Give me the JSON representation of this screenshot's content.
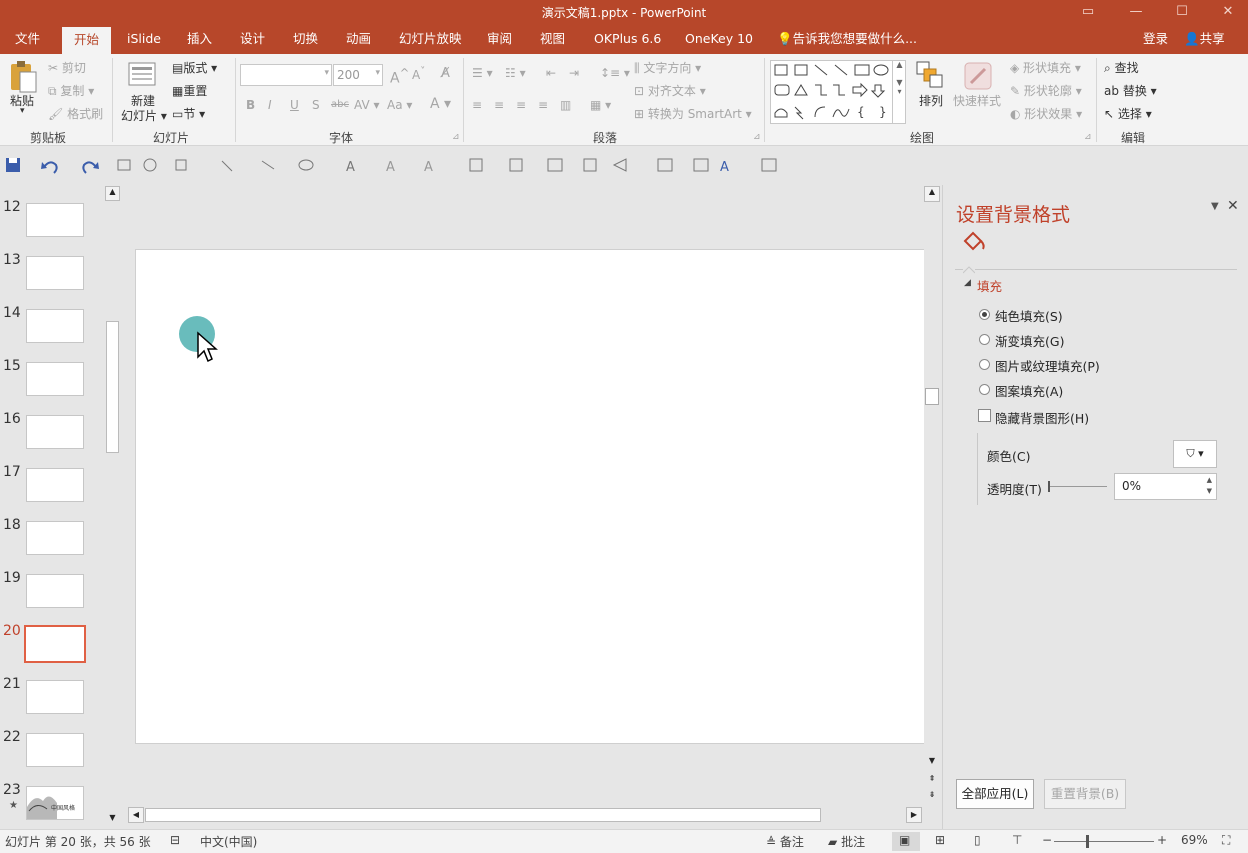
{
  "window": {
    "title": "演示文稿1.pptx - PowerPoint"
  },
  "tabs": [
    "文件",
    "开始",
    "iSlide",
    "插入",
    "设计",
    "切换",
    "动画",
    "幻灯片放映",
    "审阅",
    "视图",
    "OKPlus 6.6",
    "OneKey 10"
  ],
  "active_tab": "开始",
  "tell_me": "告诉我您想要做什么...",
  "account": {
    "login": "登录",
    "share": "共享"
  },
  "ribbon": {
    "clipboard": {
      "paste": "粘贴",
      "cut": "剪切",
      "copy": "复制",
      "format_painter": "格式刷",
      "label": "剪贴板"
    },
    "slides": {
      "new_slide_1": "新建",
      "new_slide_2": "幻灯片",
      "layout": "版式",
      "reset": "重置",
      "section": "节",
      "label": "幻灯片"
    },
    "font": {
      "name": "",
      "size": "200",
      "label": "字体",
      "bold": "B",
      "italic": "I",
      "underline": "U",
      "shadow": "S",
      "strike": "abc",
      "spacing": "AV",
      "case": "Aa",
      "color": "A"
    },
    "paragraph": {
      "text_direction": "文字方向",
      "align_text": "对齐文本",
      "smartart": "转换为 SmartArt",
      "label": "段落"
    },
    "drawing": {
      "arrange": "排列",
      "quick_styles": "快速样式",
      "shape_fill": "形状填充",
      "shape_outline": "形状轮廓",
      "shape_effects": "形状效果",
      "label": "绘图"
    },
    "editing": {
      "find": "查找",
      "replace": "替换",
      "select": "选择",
      "label": "编辑"
    }
  },
  "thumbnails": [
    {
      "num": "12",
      "selected": false
    },
    {
      "num": "13",
      "selected": false
    },
    {
      "num": "14",
      "selected": false
    },
    {
      "num": "15",
      "selected": false
    },
    {
      "num": "16",
      "selected": false
    },
    {
      "num": "17",
      "selected": false
    },
    {
      "num": "18",
      "selected": false
    },
    {
      "num": "19",
      "selected": false
    },
    {
      "num": "20",
      "selected": true
    },
    {
      "num": "21",
      "selected": false
    },
    {
      "num": "22",
      "selected": false
    },
    {
      "num": "23",
      "selected": false
    }
  ],
  "thumbnail_23_star": "★",
  "thumbnail_23_caption": "中国风格",
  "pane": {
    "title": "设置背景格式",
    "section": "填充",
    "options": [
      {
        "label": "纯色填充(S)",
        "selected": true
      },
      {
        "label": "渐变填充(G)",
        "selected": false
      },
      {
        "label": "图片或纹理填充(P)",
        "selected": false
      },
      {
        "label": "图案填充(A)",
        "selected": false
      }
    ],
    "hide_bg": "隐藏背景图形(H)",
    "color_label": "颜色(C)",
    "transparency_label": "透明度(T)",
    "transparency_value": "0%",
    "apply_all": "全部应用(L)",
    "reset_bg": "重置背景(B)"
  },
  "status": {
    "slide_info": "幻灯片 第 20 张，共 56 张",
    "language": "中文(中国)",
    "notes": "备注",
    "comments": "批注",
    "zoom": "69%",
    "zoom_minus": "−",
    "zoom_plus": "+"
  },
  "colors": {
    "accent": "#b7472a",
    "pane_title": "#c0412a",
    "cursor_dot": "#4fb0b0"
  }
}
